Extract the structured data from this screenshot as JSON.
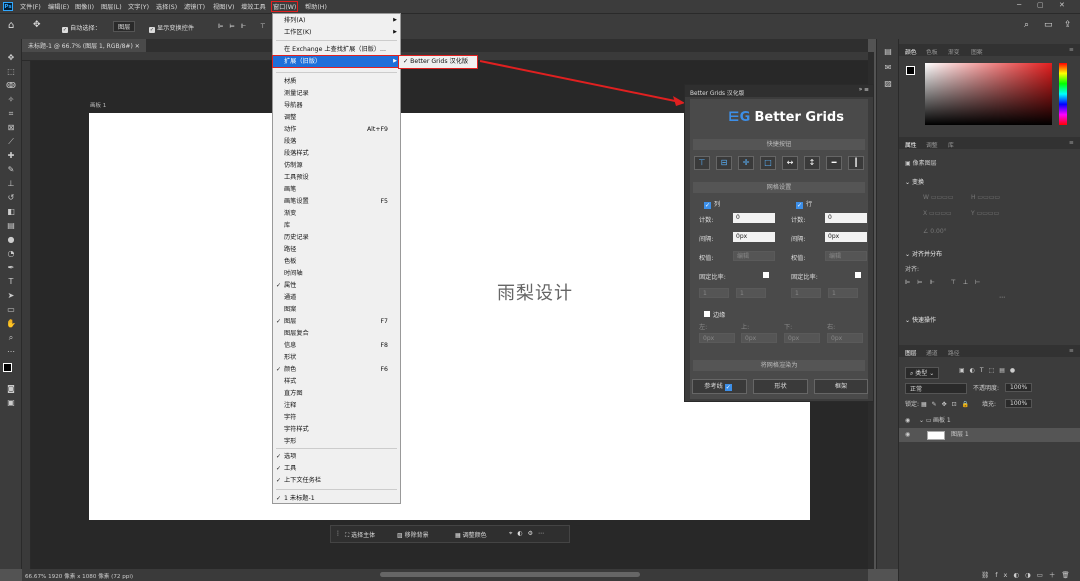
{
  "menubar": {
    "items": [
      "文件(F)",
      "编辑(E)",
      "图像(I)",
      "图层(L)",
      "文字(Y)",
      "选择(S)",
      "滤镜(T)",
      "视图(V)",
      "增效工具",
      "窗口(W)",
      "帮助(H)"
    ]
  },
  "optionsbar": {
    "auto_select_label": "自动选择：",
    "auto_select_value": "图层",
    "transform_label": "显示变换控件"
  },
  "document": {
    "tab": "未标题-1 @ 66.7% (图层 1, RGB/8#)",
    "artboard_label": "画板 1",
    "canvas_text": "雨梨设计",
    "status": "66.67%   1920 像素 x 1080 像素 (72 ppi)"
  },
  "context_bar": {
    "select_subject": "选择主体",
    "remove_bg": "移除背景",
    "adjust_color": "调整颜色"
  },
  "window_menu": {
    "items": [
      {
        "label": "排列(A)",
        "arrow": true
      },
      {
        "label": "工作区(K)",
        "arrow": true
      },
      {
        "label": "在 Exchange 上查找扩展（旧版）..."
      },
      {
        "label": "扩展（旧版）",
        "arrow": true
      },
      {
        "label": "材质"
      },
      {
        "label": "测量记录"
      },
      {
        "label": "导航器"
      },
      {
        "label": "调整"
      },
      {
        "label": "动作",
        "shortcut": "Alt+F9"
      },
      {
        "label": "段落"
      },
      {
        "label": "段落样式"
      },
      {
        "label": "仿制源"
      },
      {
        "label": "工具预设"
      },
      {
        "label": "画笔"
      },
      {
        "label": "画笔设置",
        "shortcut": "F5"
      },
      {
        "label": "渐变"
      },
      {
        "label": "库"
      },
      {
        "label": "历史记录"
      },
      {
        "label": "路径"
      },
      {
        "label": "色板"
      },
      {
        "label": "时间轴"
      },
      {
        "label": "属性",
        "checked": true
      },
      {
        "label": "通道"
      },
      {
        "label": "图案"
      },
      {
        "label": "图层",
        "checked": true,
        "shortcut": "F7"
      },
      {
        "label": "图层复合"
      },
      {
        "label": "信息",
        "shortcut": "F8"
      },
      {
        "label": "形状"
      },
      {
        "label": "颜色",
        "checked": true,
        "shortcut": "F6"
      },
      {
        "label": "样式"
      },
      {
        "label": "直方图"
      },
      {
        "label": "注释"
      },
      {
        "label": "字符"
      },
      {
        "label": "字符样式"
      },
      {
        "label": "字形"
      },
      {
        "label": "选项",
        "checked": true
      },
      {
        "label": "工具",
        "checked": true
      },
      {
        "label": "上下文任务栏",
        "checked": true
      },
      {
        "label": "1 未标题-1",
        "checked": true
      }
    ],
    "submenu_item": "Better Grids 汉化版"
  },
  "better_grids": {
    "panel_title": "Better Grids 汉化版",
    "logo_text": "Better Grids",
    "quick_buttons_title": "快捷按钮",
    "grid_settings_title": "网格设置",
    "col_label": "列",
    "row_label": "行",
    "count_label": "计数:",
    "gap_label": "间隔:",
    "weight_label": "权值:",
    "fixed_ratio_label": "固定比率:",
    "col_count": "0",
    "row_count": "0",
    "col_gap": "0px",
    "row_gap": "0px",
    "weight_value": "编辑",
    "ratio_a": "1",
    "ratio_b": "1",
    "margin_label": "边缘",
    "margin_top": "上:",
    "margin_left": "左:",
    "margin_bottom": "下:",
    "margin_right": "右:",
    "margin_values": [
      "0px",
      "0px",
      "0px",
      "0px"
    ],
    "render_title": "将网格渲染为",
    "btn_guides": "参考线",
    "btn_shape": "形状",
    "btn_frame": "框架"
  },
  "right_panel": {
    "color_tabs": [
      "颜色",
      "色板",
      "渐变",
      "图案"
    ],
    "prop_tabs": [
      "属性",
      "调整",
      "库"
    ],
    "pixel_layer": "像素图层",
    "transform": "变换",
    "transform_w": "W",
    "transform_h": "H",
    "transform_x": "X",
    "transform_y": "Y",
    "transform_angle": "0.00°",
    "align_title": "对齐并分布",
    "align_label": "对齐:",
    "quick_actions": "快速操作",
    "layer_tabs": [
      "图层",
      "通道",
      "路径"
    ],
    "kind_label": "类型",
    "blend_mode": "正常",
    "opacity_label": "不透明度:",
    "opacity_value": "100%",
    "lock_label": "锁定:",
    "fill_label": "填充:",
    "fill_value": "100%",
    "artboard_layer": "画板 1",
    "pixel_layer_name": "图层 1"
  },
  "colors": {
    "accent_blue": "#1e6fd9",
    "highlight_red": "#e02020"
  }
}
